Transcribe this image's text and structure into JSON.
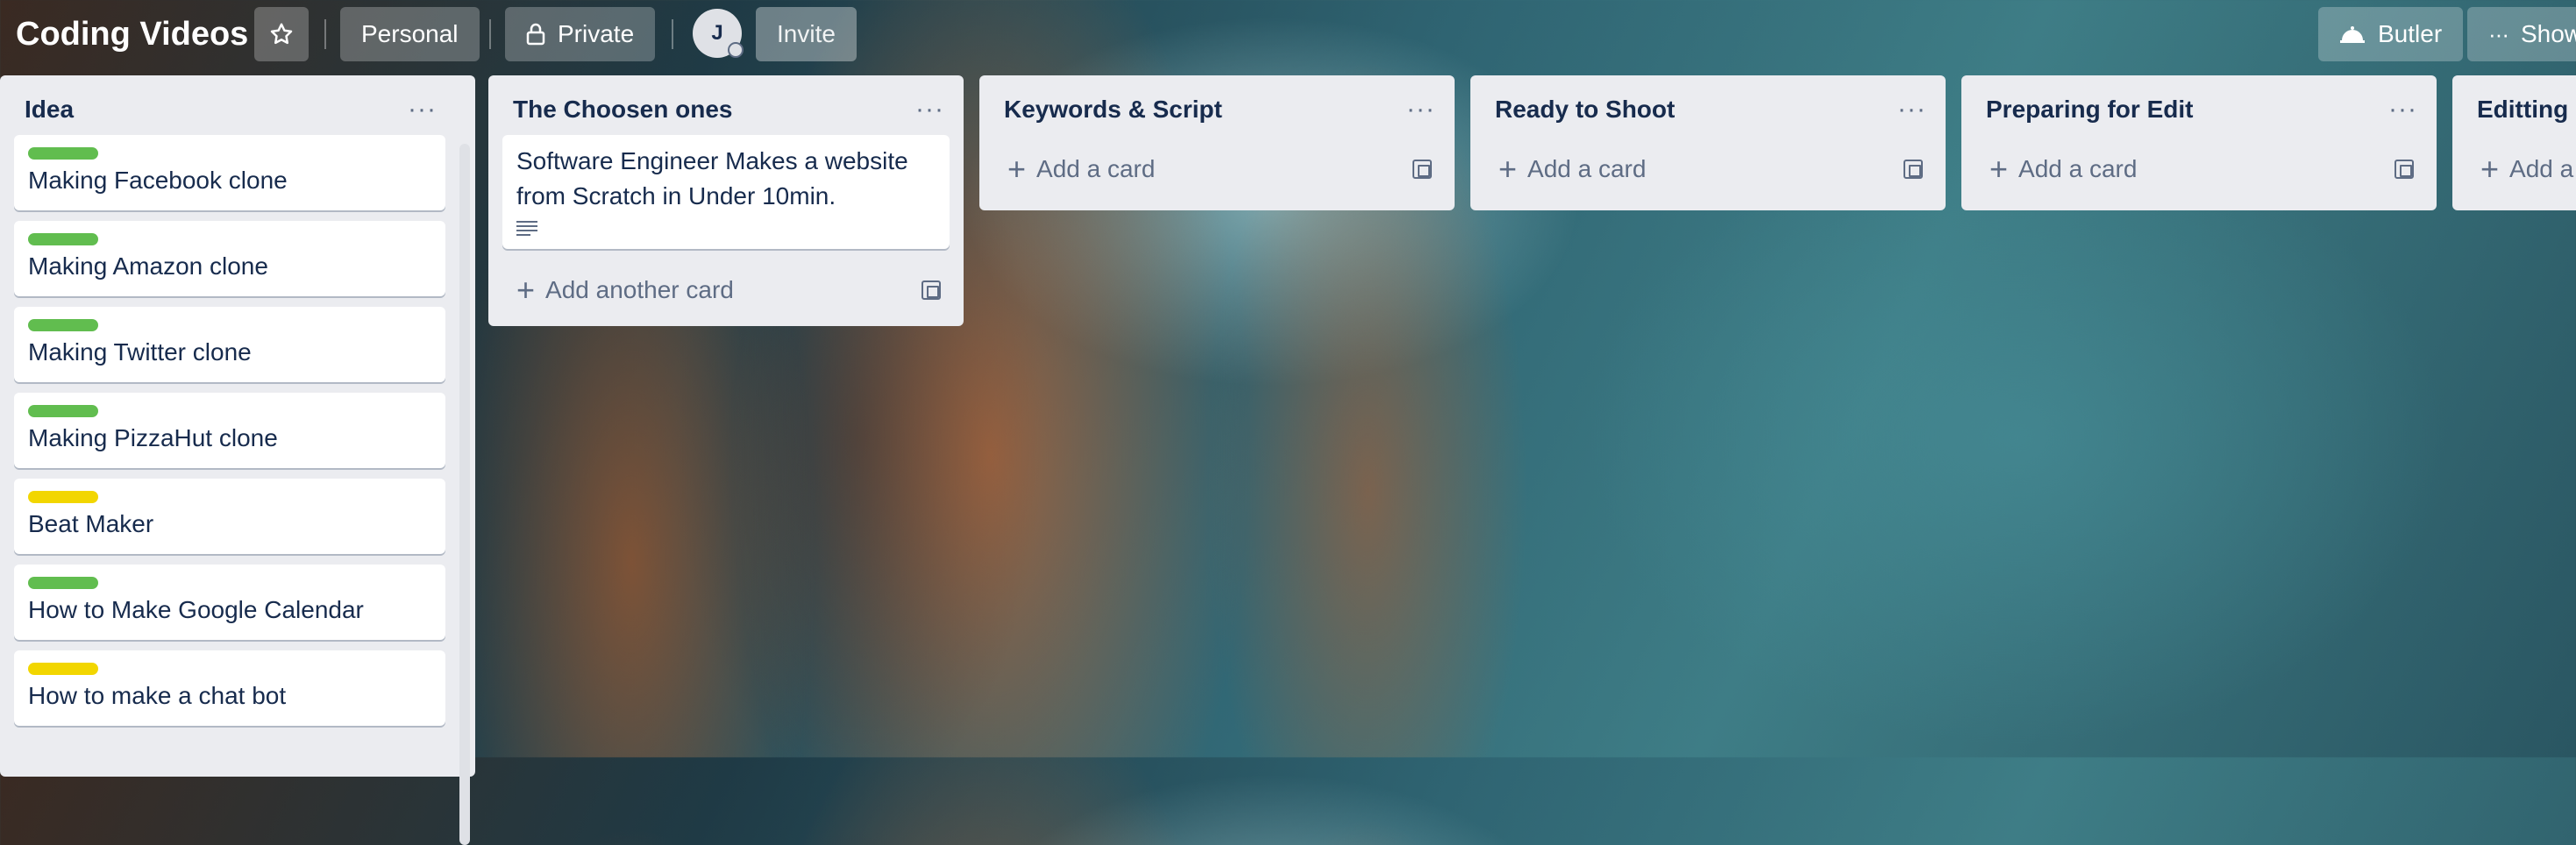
{
  "header": {
    "board_title": "Coding Videos",
    "star_icon": "star-icon",
    "workspace_label": "Personal",
    "visibility_label": "Private",
    "visibility_icon": "lock-icon",
    "member_initial": "J",
    "invite_label": "Invite",
    "butler_label": "Butler",
    "butler_icon": "butler-icon",
    "show_menu_label": "Show",
    "more_icon": "ellipsis-icon"
  },
  "lists": [
    {
      "title": "Idea",
      "cards": [
        {
          "label_color": "#61bd4f",
          "text": "Making Facebook clone"
        },
        {
          "label_color": "#61bd4f",
          "text": "Making Amazon clone"
        },
        {
          "label_color": "#61bd4f",
          "text": "Making Twitter clone"
        },
        {
          "label_color": "#61bd4f",
          "text": "Making PizzaHut clone"
        },
        {
          "label_color": "#f2d600",
          "text": "Beat Maker"
        },
        {
          "label_color": "#61bd4f",
          "text": "How to Make Google Calendar"
        },
        {
          "label_color": "#f2d600",
          "text": "How to make a chat bot"
        }
      ]
    },
    {
      "title": "The Choosen ones",
      "cards": [
        {
          "text": "Software Engineer Makes a website from Scratch in Under 10min.",
          "has_description": true
        }
      ],
      "add_label": "Add another card"
    },
    {
      "title": "Keywords & Script",
      "add_label": "Add a card"
    },
    {
      "title": "Ready to Shoot",
      "add_label": "Add a card"
    },
    {
      "title": "Preparing for Edit",
      "add_label": "Add a card"
    },
    {
      "title": "Editting",
      "add_label": "Add a"
    }
  ],
  "colors": {
    "label_green": "#61bd4f",
    "label_yellow": "#f2d600",
    "list_bg": "#ebecf0"
  }
}
